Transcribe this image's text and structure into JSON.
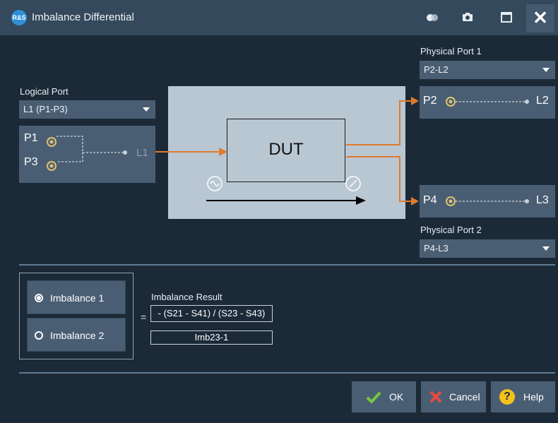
{
  "window": {
    "title": "Imbalance Differential",
    "logo_text": "R&S"
  },
  "logical_port": {
    "label": "Logical Port",
    "selected": "L1 (P1-P3)",
    "ports": [
      "P1",
      "P3"
    ],
    "logical_name": "L1"
  },
  "dut": {
    "label": "DUT"
  },
  "physical_port_1": {
    "label": "Physical Port 1",
    "selected": "P2-L2",
    "port": "P2",
    "logical_name": "L2"
  },
  "physical_port_2": {
    "label": "Physical Port 2",
    "selected": "P4-L3",
    "port": "P4",
    "logical_name": "L3"
  },
  "imbalance": {
    "options": [
      "Imbalance 1",
      "Imbalance 2"
    ],
    "selected_index": 0,
    "result_label": "Imbalance Result",
    "equals": "=",
    "formula": "- (S21 - S41) / (S23 - S43)",
    "name": "Imb23-1"
  },
  "buttons": {
    "ok": "OK",
    "cancel": "Cancel",
    "help": "Help"
  },
  "colors": {
    "accent_orange": "#e07a2e",
    "panel": "#4a5e73",
    "background": "#1c2a38"
  }
}
